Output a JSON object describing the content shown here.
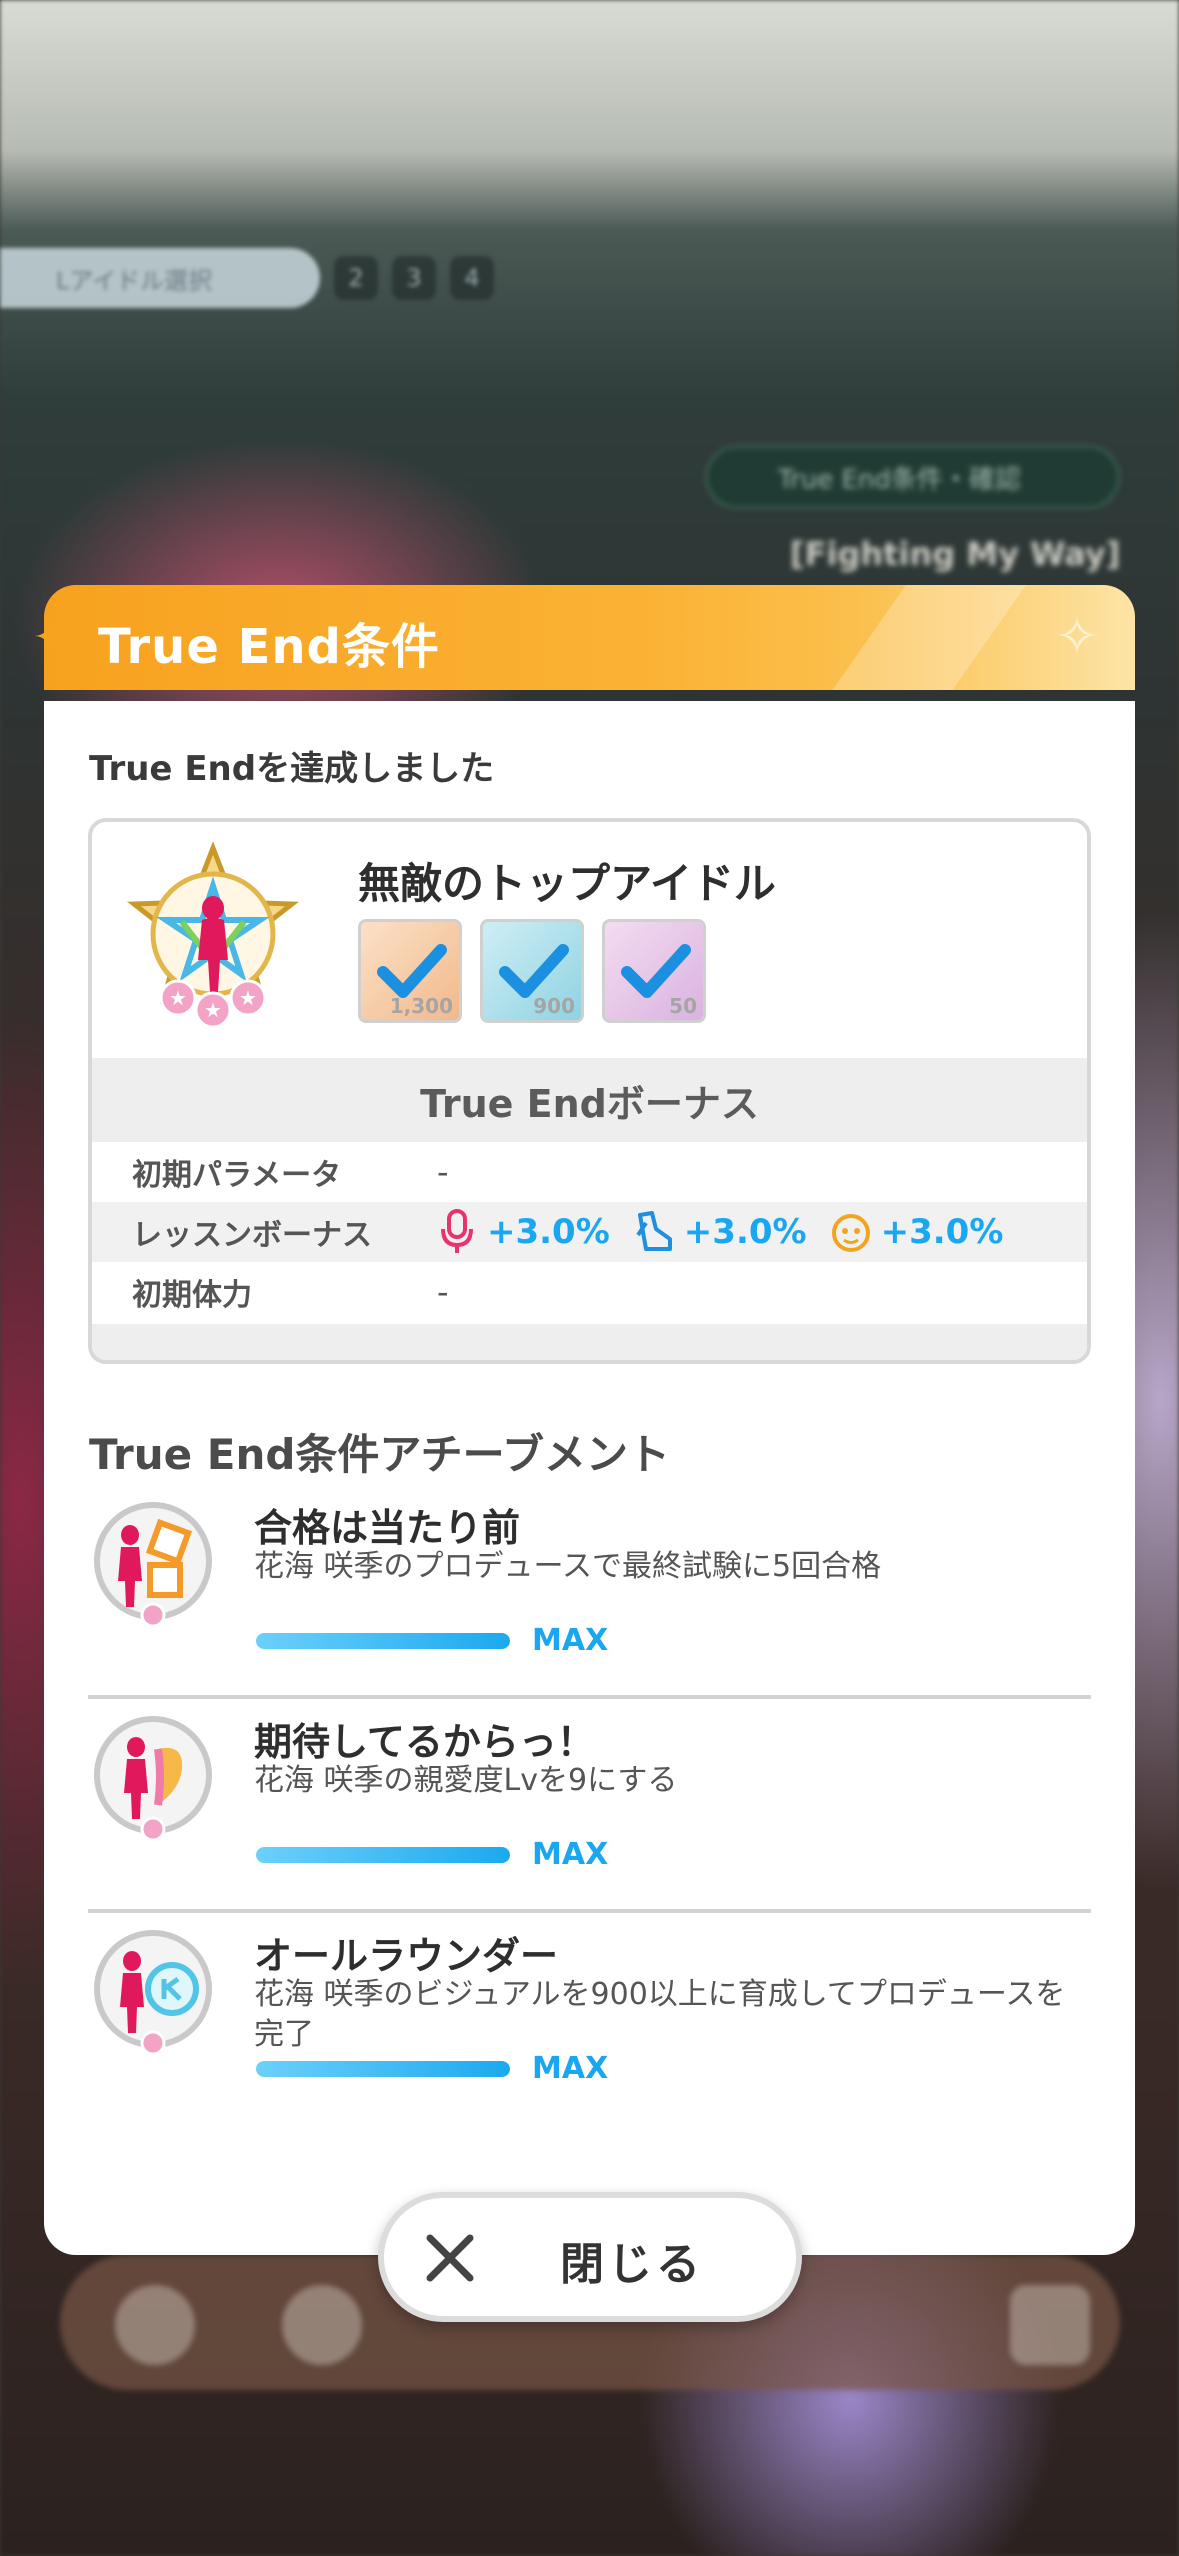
{
  "background": {
    "tab_pill_label": "Lアイドル選択",
    "tab_numbers": [
      "2",
      "3",
      "4"
    ],
    "true_end_chip": "True End条件・確認",
    "song_title": "[Fighting My Way]"
  },
  "modal": {
    "title": "True End条件",
    "completed_label": "True Endを達成しました",
    "header_color": "#f7a21f",
    "card": {
      "name": "無敵のトップアイドル",
      "requirements": [
        {
          "icon": "vocal-item-icon",
          "value": "1,300",
          "checked": true
        },
        {
          "icon": "dance-item-icon",
          "value": "900",
          "checked": true
        },
        {
          "icon": "visual-item-icon",
          "value": "50",
          "checked": true
        }
      ],
      "bonus_heading": "True Endボーナス",
      "rows": {
        "initial_params": {
          "label": "初期パラメータ",
          "value": "-"
        },
        "lesson_bonus": {
          "label": "レッスンボーナス",
          "vocal": "+3.0%",
          "dance": "+3.0%",
          "visual": "+3.0%"
        },
        "initial_stamina": {
          "label": "初期体力",
          "value": "-"
        }
      }
    },
    "achievements_title": "True End条件アチーブメント",
    "achievements": [
      {
        "name": "合格は当たり前",
        "desc": "花海 咲季のプロデュースで最終試験に5回合格",
        "progress": 1.0,
        "status": "MAX"
      },
      {
        "name": "期待してるからっ！",
        "desc": "花海 咲季の親愛度Lvを9にする",
        "progress": 1.0,
        "status": "MAX"
      },
      {
        "name": "オールラウンダー",
        "desc": "花海 咲季のビジュアルを900以上に育成してプロデュースを完了",
        "progress": 1.0,
        "status": "MAX"
      }
    ],
    "close_label": "閉じる",
    "accent_color": "#1aa6f0"
  }
}
